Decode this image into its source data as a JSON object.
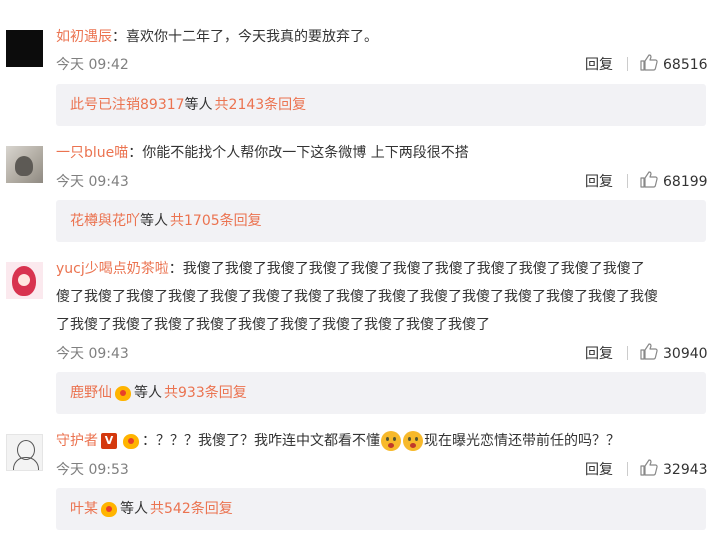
{
  "comments": [
    {
      "username": "如初遇辰",
      "text": "：喜欢你十二年了，今天我真的要放弃了。",
      "time": "今天 09:42",
      "reply_label": "回复",
      "likes": "68516",
      "sub": {
        "user": "此号已注销89317",
        "mid": " 等人 ",
        "count": "共2143条回复"
      }
    },
    {
      "username": "一只blue喵",
      "text": "：你能不能找个人帮你改一下这条微博 上下两段很不搭",
      "time": "今天 09:43",
      "reply_label": "回复",
      "likes": "68199",
      "sub": {
        "user": "花樽與花吖",
        "mid": " 等人 ",
        "count": "共1705条回复"
      }
    },
    {
      "username": "yucj少喝点奶茶啦",
      "text_line1": "：我傻了我傻了我傻了我傻了我傻了我傻了我傻了我傻了我傻了我傻了我傻了",
      "text_line2": "傻了我傻了我傻了我傻了我傻了我傻了我傻了我傻了我傻了我傻了我傻了我傻了我傻了我傻了我傻",
      "text_line3": "了我傻了我傻了我傻了我傻了我傻了我傻了我傻了我傻了我傻了我傻了",
      "time": "今天 09:43",
      "reply_label": "回复",
      "likes": "30940",
      "sub": {
        "user": "鹿野仙",
        "mid": " 等人 ",
        "count": "共933条回复"
      }
    },
    {
      "username": "守护者",
      "badge_v": "V",
      "text_a": "：？？？我傻了？我咋连中文都看不懂",
      "text_b": "现在曝光恋情还带前任的吗？？",
      "time": "今天 09:53",
      "reply_label": "回复",
      "likes": "32943",
      "sub": {
        "user": "叶某",
        "mid": " 等人 ",
        "count": "共542条回复"
      }
    }
  ],
  "icons": {
    "like": "thumbs-up-icon",
    "emoji": "astonished-face-icon",
    "vip": "vip-crown-icon"
  },
  "colors": {
    "username": "#eb7350",
    "meta": "#808080",
    "sub_bg": "#f2f2f5"
  }
}
